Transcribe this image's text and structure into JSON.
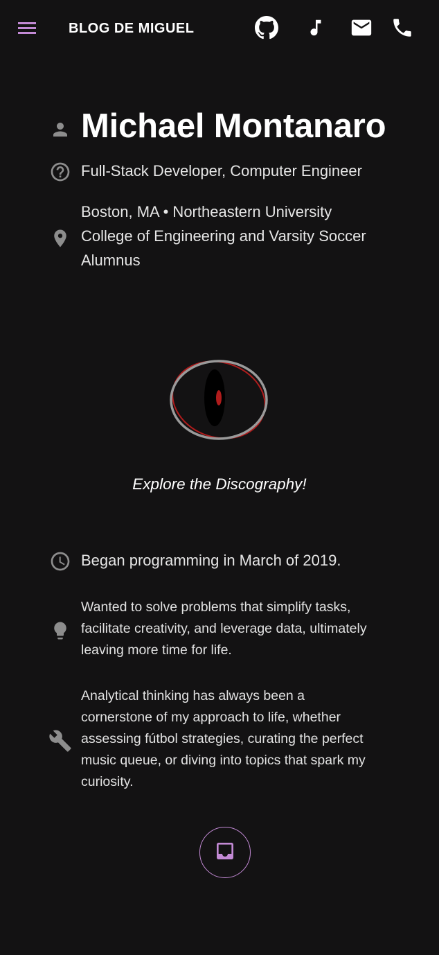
{
  "header": {
    "brand": "BLOG DE MIGUEL",
    "icons": [
      "menu-icon",
      "github-icon",
      "music-note-icon",
      "mail-icon",
      "phone-icon"
    ],
    "accent_color": "#c38ad5"
  },
  "profile": {
    "name": "Michael Montanaro",
    "role": "Full-Stack Developer, Computer Engineer",
    "location_lines": [
      "Boston, MA • Northeastern University",
      "College of Engineering and Varsity Soccer",
      "Alumnus"
    ]
  },
  "discography": {
    "caption": "Explore the Discography!",
    "logo_colors": {
      "ring": "#9a9a9a",
      "accent": "#b01c1c",
      "pupil": "#000000"
    }
  },
  "facts": {
    "began": "Began programming in March of 2019.",
    "motivation": [
      "Wanted to solve problems that simplify tasks,",
      "facilitate creativity, and leverage data, ultimately",
      "leaving more time for life."
    ],
    "approach": [
      "Analytical thinking has always been a",
      "cornerstone of my approach to life, whether",
      "assessing fútbol strategies, curating the perfect",
      "music queue, or diving into topics that spark my",
      "curiosity."
    ]
  },
  "icon_color": "#8d8d8d"
}
